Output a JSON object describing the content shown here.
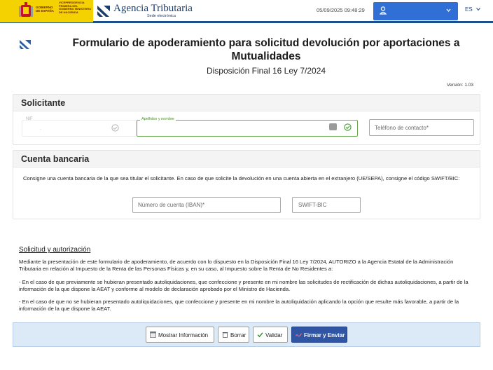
{
  "header": {
    "gov_label": "GOBIERNO DE ESPAÑA",
    "vice_label": "VICEPRESIDENCIA PRIMERA DEL GOBIERNO MINISTERIO DE HACIENDA",
    "agency_name": "Agencia Tributaria",
    "agency_sub": "Sede electrónica",
    "datetime": "05/09/2025 09:48:29",
    "user_name": "",
    "language": "ES",
    "brand_blue": "#1b4f8c",
    "gov_yellow": "#f4d100"
  },
  "page": {
    "title": "Formulario de apoderamiento para solicitud devolución por aportaciones a Mutualidades",
    "subtitle": "Disposición Final 16 Ley 7/2024",
    "version": "Versión: 1.03"
  },
  "solicitante": {
    "heading": "Solicitante",
    "nif_label": "NIF",
    "nif_value": ".",
    "name_label": "Apellidos y nombre",
    "name_value": "",
    "phone_placeholder": "Teléfono de contacto*"
  },
  "cuenta": {
    "heading": "Cuenta bancaria",
    "instructions": "Consigne una cuenta bancaria de la que sea titular el solicitante. En caso de que solicite la devolución en una cuenta abierta en el extranjero (UE/SEPA), consigne el código SWIFT/BIC:",
    "iban_placeholder": "Número de cuenta (IBAN)*",
    "swift_placeholder": "SWIFT-BIC"
  },
  "autorizacion": {
    "heading": "Solicitud y autorización",
    "p1": "Mediante la presentación de este formulario de apoderamiento, de acuerdo con lo dispuesto en la Disposición Final 16 Ley 7/2024, AUTORIZO a la Agencia Estatal de la Administración Tributaria en relación al Impuesto de la Renta de las Personas Físicas y, en su caso, al Impuesto sobre la Renta de No Residentes a:",
    "p2": "- En el caso de que previamente se hubieran presentado autoliquidaciones, que confeccione y presente en mi nombre las solicitudes de rectificación de dichas autoliquidaciones, a partir de la información de la que dispone la AEAT y conforme al modelo de declaración aprobado por el Ministro de Hacienda.",
    "p3": "- En el caso de que no se hubieran presentado autoliquidaciones, que confeccione y presente en mi nombre la autoliquidación aplicando la opción que resulte más favorable, a partir de la información de la que dispone la AEAT."
  },
  "actions": {
    "show_info": "Mostrar Información",
    "delete": "Borrar",
    "validate": "Validar",
    "sign_send": "Firmar y Enviar"
  }
}
